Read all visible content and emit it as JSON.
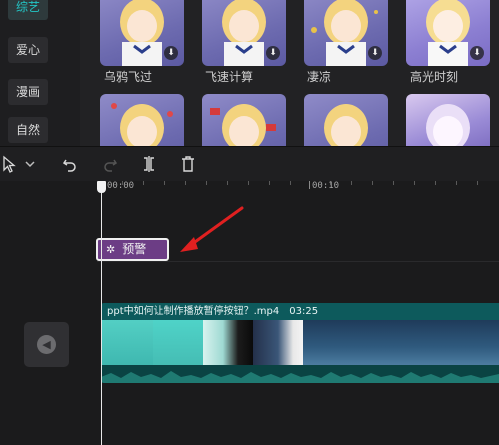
{
  "library": {
    "categories": [
      {
        "label": "综艺",
        "active": true
      },
      {
        "label": "爱心",
        "active": false
      },
      {
        "label": "漫画",
        "active": false
      },
      {
        "label": "自然",
        "active": false
      }
    ],
    "row1": [
      {
        "label": "乌鸦飞过",
        "icon": "download-icon"
      },
      {
        "label": "飞速计算",
        "icon": "download-icon"
      },
      {
        "label": "凄凉",
        "icon": "download-icon"
      },
      {
        "label": "高光时刻",
        "icon": "download-icon"
      }
    ],
    "row2_count": 4
  },
  "toolbar": {
    "icons": [
      "cursor-select-icon",
      "chevron-down-icon",
      "undo-icon",
      "redo-icon",
      "split-icon",
      "delete-icon"
    ]
  },
  "timeline": {
    "ruler_labels": [
      "00:00",
      "00:10"
    ],
    "effect_clip": {
      "label": "预警",
      "icon": "effect-star-icon",
      "color": "#6c3d85"
    },
    "video_clip": {
      "filename": "ppt中如何让制作播放暂停按钮？.mp4",
      "duration": "03:25",
      "color": "#0d5a5c"
    },
    "audio_toggle_icon": "speaker-icon",
    "accent": "#23c6c6",
    "annotation_arrow_color": "#e02020"
  }
}
